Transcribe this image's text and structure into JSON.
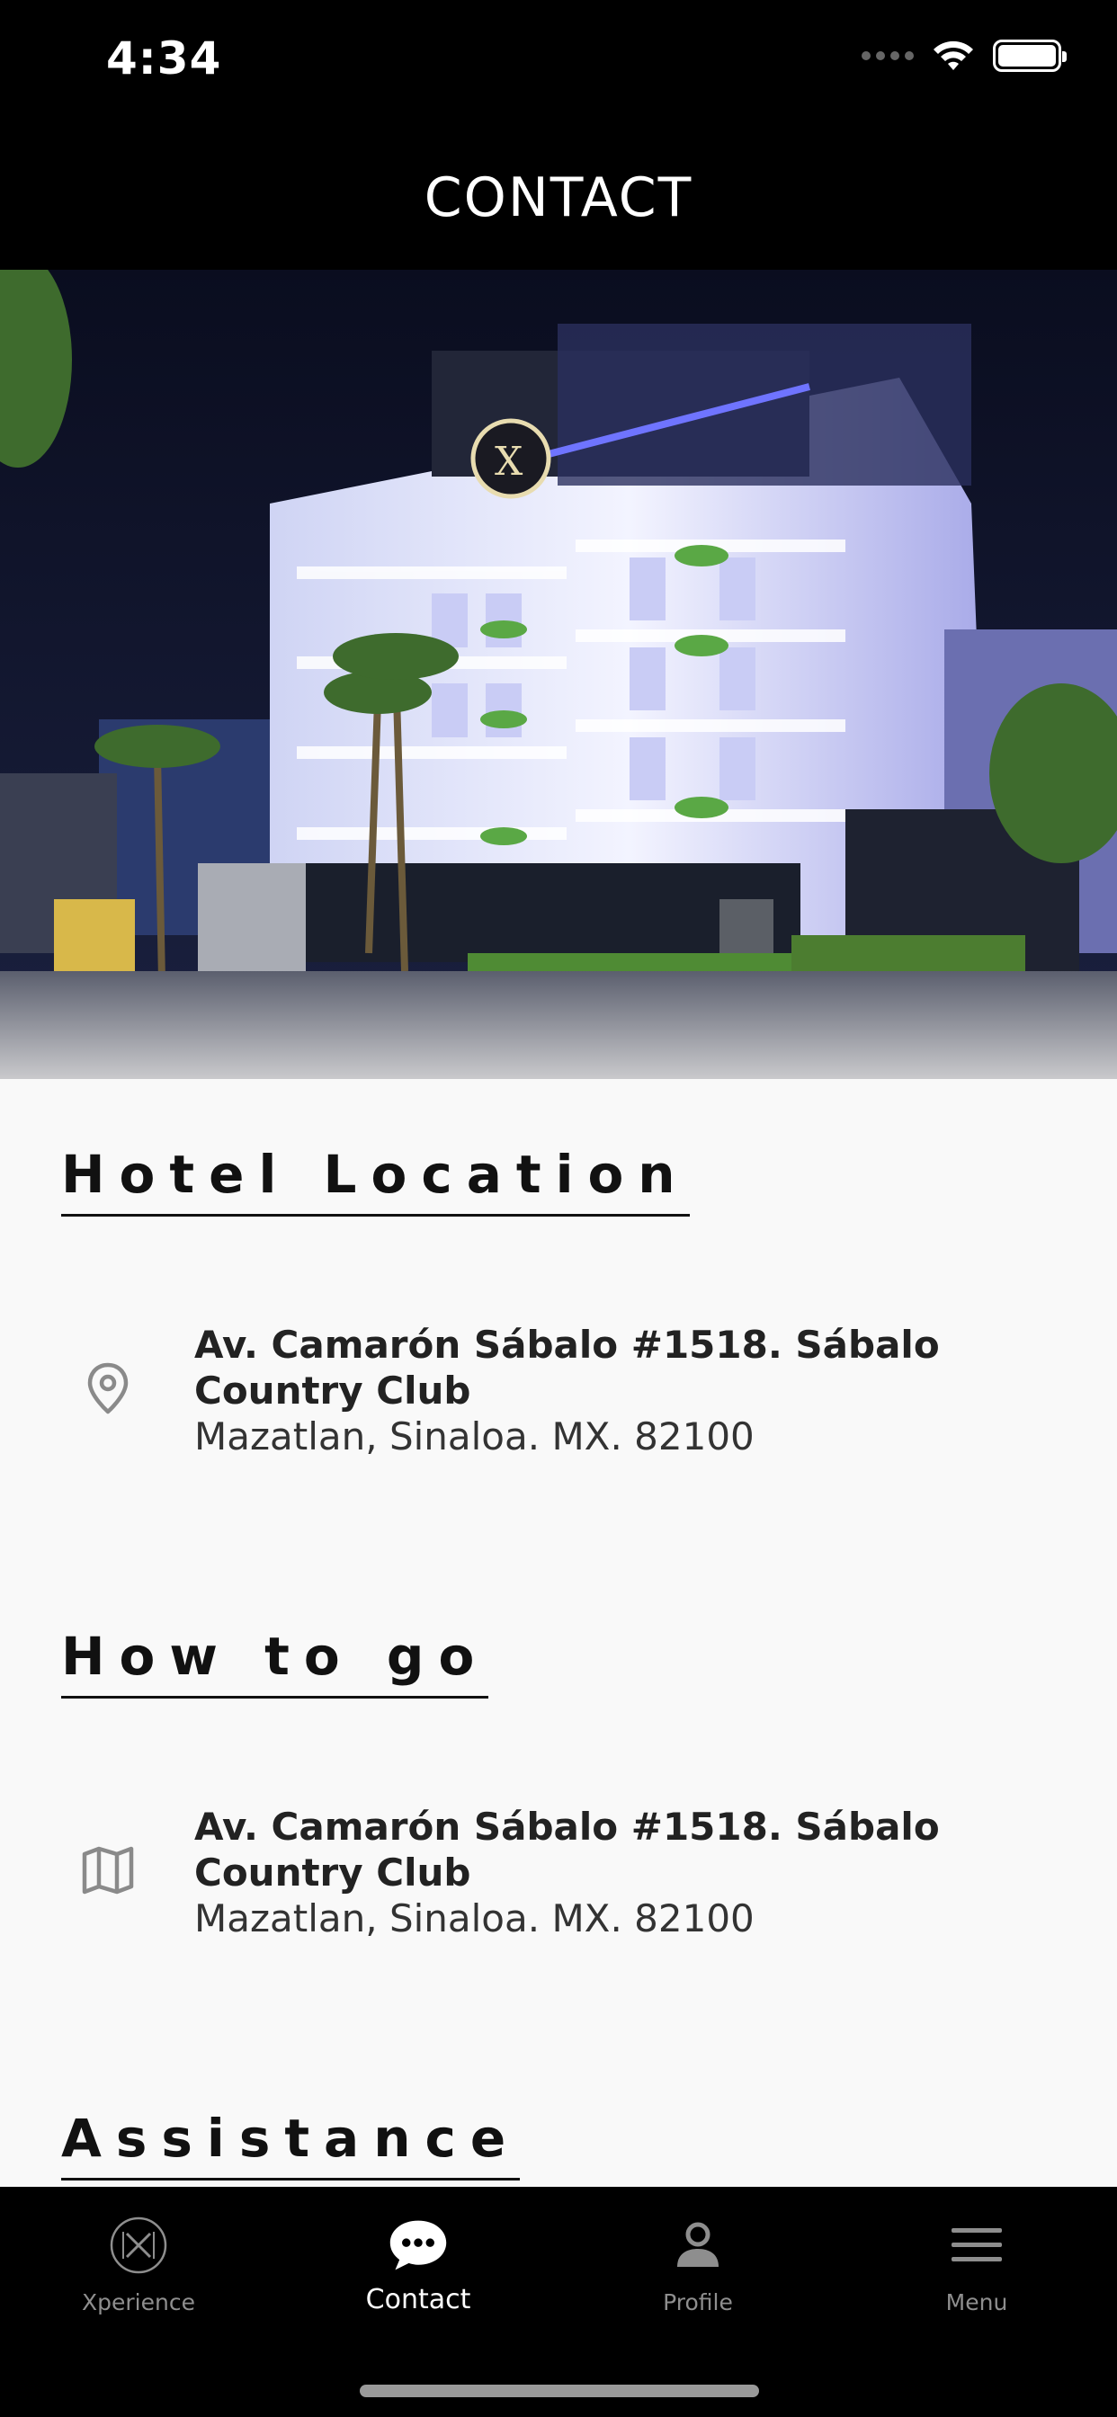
{
  "status_bar": {
    "time": "4:34"
  },
  "header": {
    "title": "CONTACT"
  },
  "hero": {
    "image_desc_icon": "hotel-photo"
  },
  "sections": {
    "location": {
      "title": "Hotel Location",
      "icon": "location-pin-icon",
      "address_line1": "Av. Camarón Sábalo #1518. Sábalo Country Club",
      "address_line2": "Mazatlan, Sinaloa. MX. 82100"
    },
    "how_to_go": {
      "title": "How to go",
      "icon": "map-icon",
      "address_line1": "Av. Camarón Sábalo #1518. Sábalo Country Club",
      "address_line2": "Mazatlan, Sinaloa. MX. 82100"
    },
    "assistance": {
      "title": "Assistance"
    }
  },
  "tabs": [
    {
      "label": "Xperience",
      "icon": "xperience-logo-icon",
      "active": false
    },
    {
      "label": "Contact",
      "icon": "chat-bubble-icon",
      "active": true
    },
    {
      "label": "Profile",
      "icon": "person-icon",
      "active": false
    },
    {
      "label": "Menu",
      "icon": "hamburger-icon",
      "active": false
    }
  ],
  "colors": {
    "active_tab": "#ffffff",
    "inactive_tab": "#8e8e8e",
    "background": "#f9f9f9",
    "header": "#000000"
  }
}
